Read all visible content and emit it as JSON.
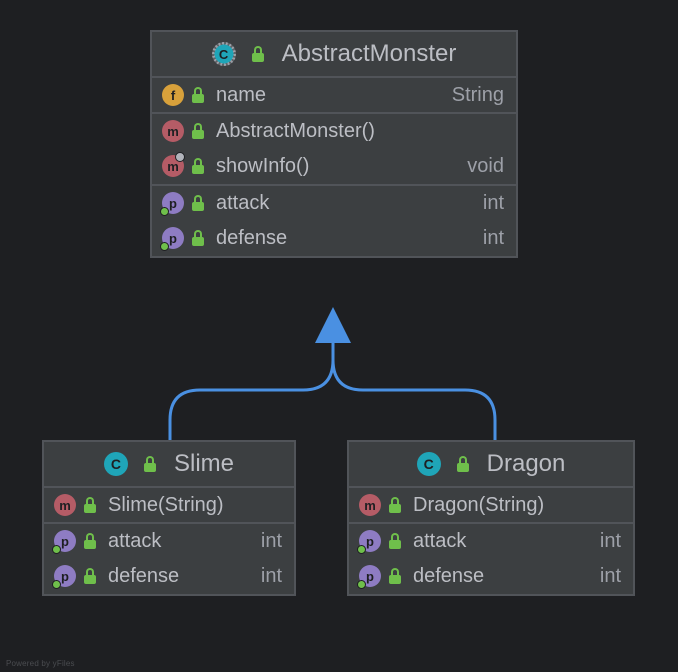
{
  "diagram": {
    "footer": "Powered by yFiles",
    "classes": {
      "abstractMonster": {
        "title": "AbstractMonster",
        "kind": "abstract-class",
        "sections": [
          [
            {
              "badge": "f",
              "name": "name",
              "type": "String"
            }
          ],
          [
            {
              "badge": "m",
              "name": "AbstractMonster()",
              "type": ""
            },
            {
              "badge": "m",
              "override": true,
              "name": "showInfo()",
              "type": "void"
            }
          ],
          [
            {
              "badge": "p",
              "dot": true,
              "name": "attack",
              "type": "int"
            },
            {
              "badge": "p",
              "dot": true,
              "name": "defense",
              "type": "int"
            }
          ]
        ]
      },
      "slime": {
        "title": "Slime",
        "kind": "class",
        "sections": [
          [
            {
              "badge": "m",
              "name": "Slime(String)",
              "type": ""
            }
          ],
          [
            {
              "badge": "p",
              "dot": true,
              "name": "attack",
              "type": "int"
            },
            {
              "badge": "p",
              "dot": true,
              "name": "defense",
              "type": "int"
            }
          ]
        ]
      },
      "dragon": {
        "title": "Dragon",
        "kind": "class",
        "sections": [
          [
            {
              "badge": "m",
              "name": "Dragon(String)",
              "type": ""
            }
          ],
          [
            {
              "badge": "p",
              "dot": true,
              "name": "attack",
              "type": "int"
            },
            {
              "badge": "p",
              "dot": true,
              "name": "defense",
              "type": "int"
            }
          ]
        ]
      }
    },
    "edges": [
      {
        "from": "slime",
        "to": "abstractMonster",
        "type": "generalization"
      },
      {
        "from": "dragon",
        "to": "abstractMonster",
        "type": "generalization"
      }
    ]
  },
  "colors": {
    "background": "#1e1f22",
    "boxBorder": "#515459",
    "boxFill": "#3c3f41",
    "text": "#bcbec4",
    "accentEdge": "#4a90e2",
    "lockGreen": "#6fbf4b",
    "iconClass": "#1fa5b8",
    "iconField": "#d8a13b",
    "iconMethod": "#b55c66",
    "iconProperty": "#8e7cc3"
  }
}
